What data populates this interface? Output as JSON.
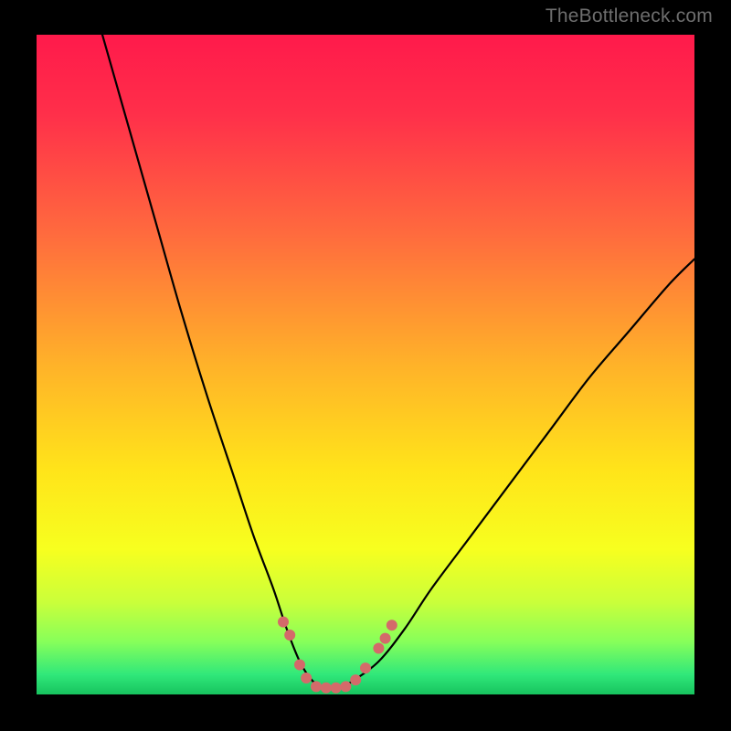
{
  "watermark": "TheBottleneck.com",
  "chart_data": {
    "type": "line",
    "title": "",
    "xlabel": "",
    "ylabel": "",
    "xlim": [
      0,
      100
    ],
    "ylim": [
      0,
      100
    ],
    "gradient_stops": [
      {
        "offset": 0.0,
        "color": "#ff1a4b"
      },
      {
        "offset": 0.12,
        "color": "#ff2f4a"
      },
      {
        "offset": 0.3,
        "color": "#ff6a3e"
      },
      {
        "offset": 0.5,
        "color": "#ffb229"
      },
      {
        "offset": 0.66,
        "color": "#ffe41a"
      },
      {
        "offset": 0.78,
        "color": "#f7ff1f"
      },
      {
        "offset": 0.86,
        "color": "#caff3a"
      },
      {
        "offset": 0.92,
        "color": "#87ff5a"
      },
      {
        "offset": 0.97,
        "color": "#30e87a"
      },
      {
        "offset": 1.0,
        "color": "#17c35e"
      }
    ],
    "series": [
      {
        "name": "bottleneck-curve",
        "x": [
          10,
          14,
          18,
          22,
          26,
          30,
          33,
          36,
          38,
          40,
          42,
          44,
          46,
          48,
          52,
          56,
          60,
          66,
          72,
          78,
          84,
          90,
          96,
          100
        ],
        "y": [
          100,
          86,
          72,
          58,
          45,
          33,
          24,
          16,
          10,
          5,
          2,
          1,
          1,
          2,
          5,
          10,
          16,
          24,
          32,
          40,
          48,
          55,
          62,
          66
        ]
      }
    ],
    "markers": {
      "color": "#d46a6a",
      "radius_px": 6,
      "points": [
        {
          "x": 37.5,
          "y": 11
        },
        {
          "x": 38.5,
          "y": 9
        },
        {
          "x": 40.0,
          "y": 4.5
        },
        {
          "x": 41.0,
          "y": 2.5
        },
        {
          "x": 42.5,
          "y": 1.2
        },
        {
          "x": 44.0,
          "y": 1.0
        },
        {
          "x": 45.5,
          "y": 1.0
        },
        {
          "x": 47.0,
          "y": 1.2
        },
        {
          "x": 48.5,
          "y": 2.2
        },
        {
          "x": 50.0,
          "y": 4.0
        },
        {
          "x": 52.0,
          "y": 7.0
        },
        {
          "x": 53.0,
          "y": 8.5
        },
        {
          "x": 54.0,
          "y": 10.5
        }
      ]
    }
  }
}
